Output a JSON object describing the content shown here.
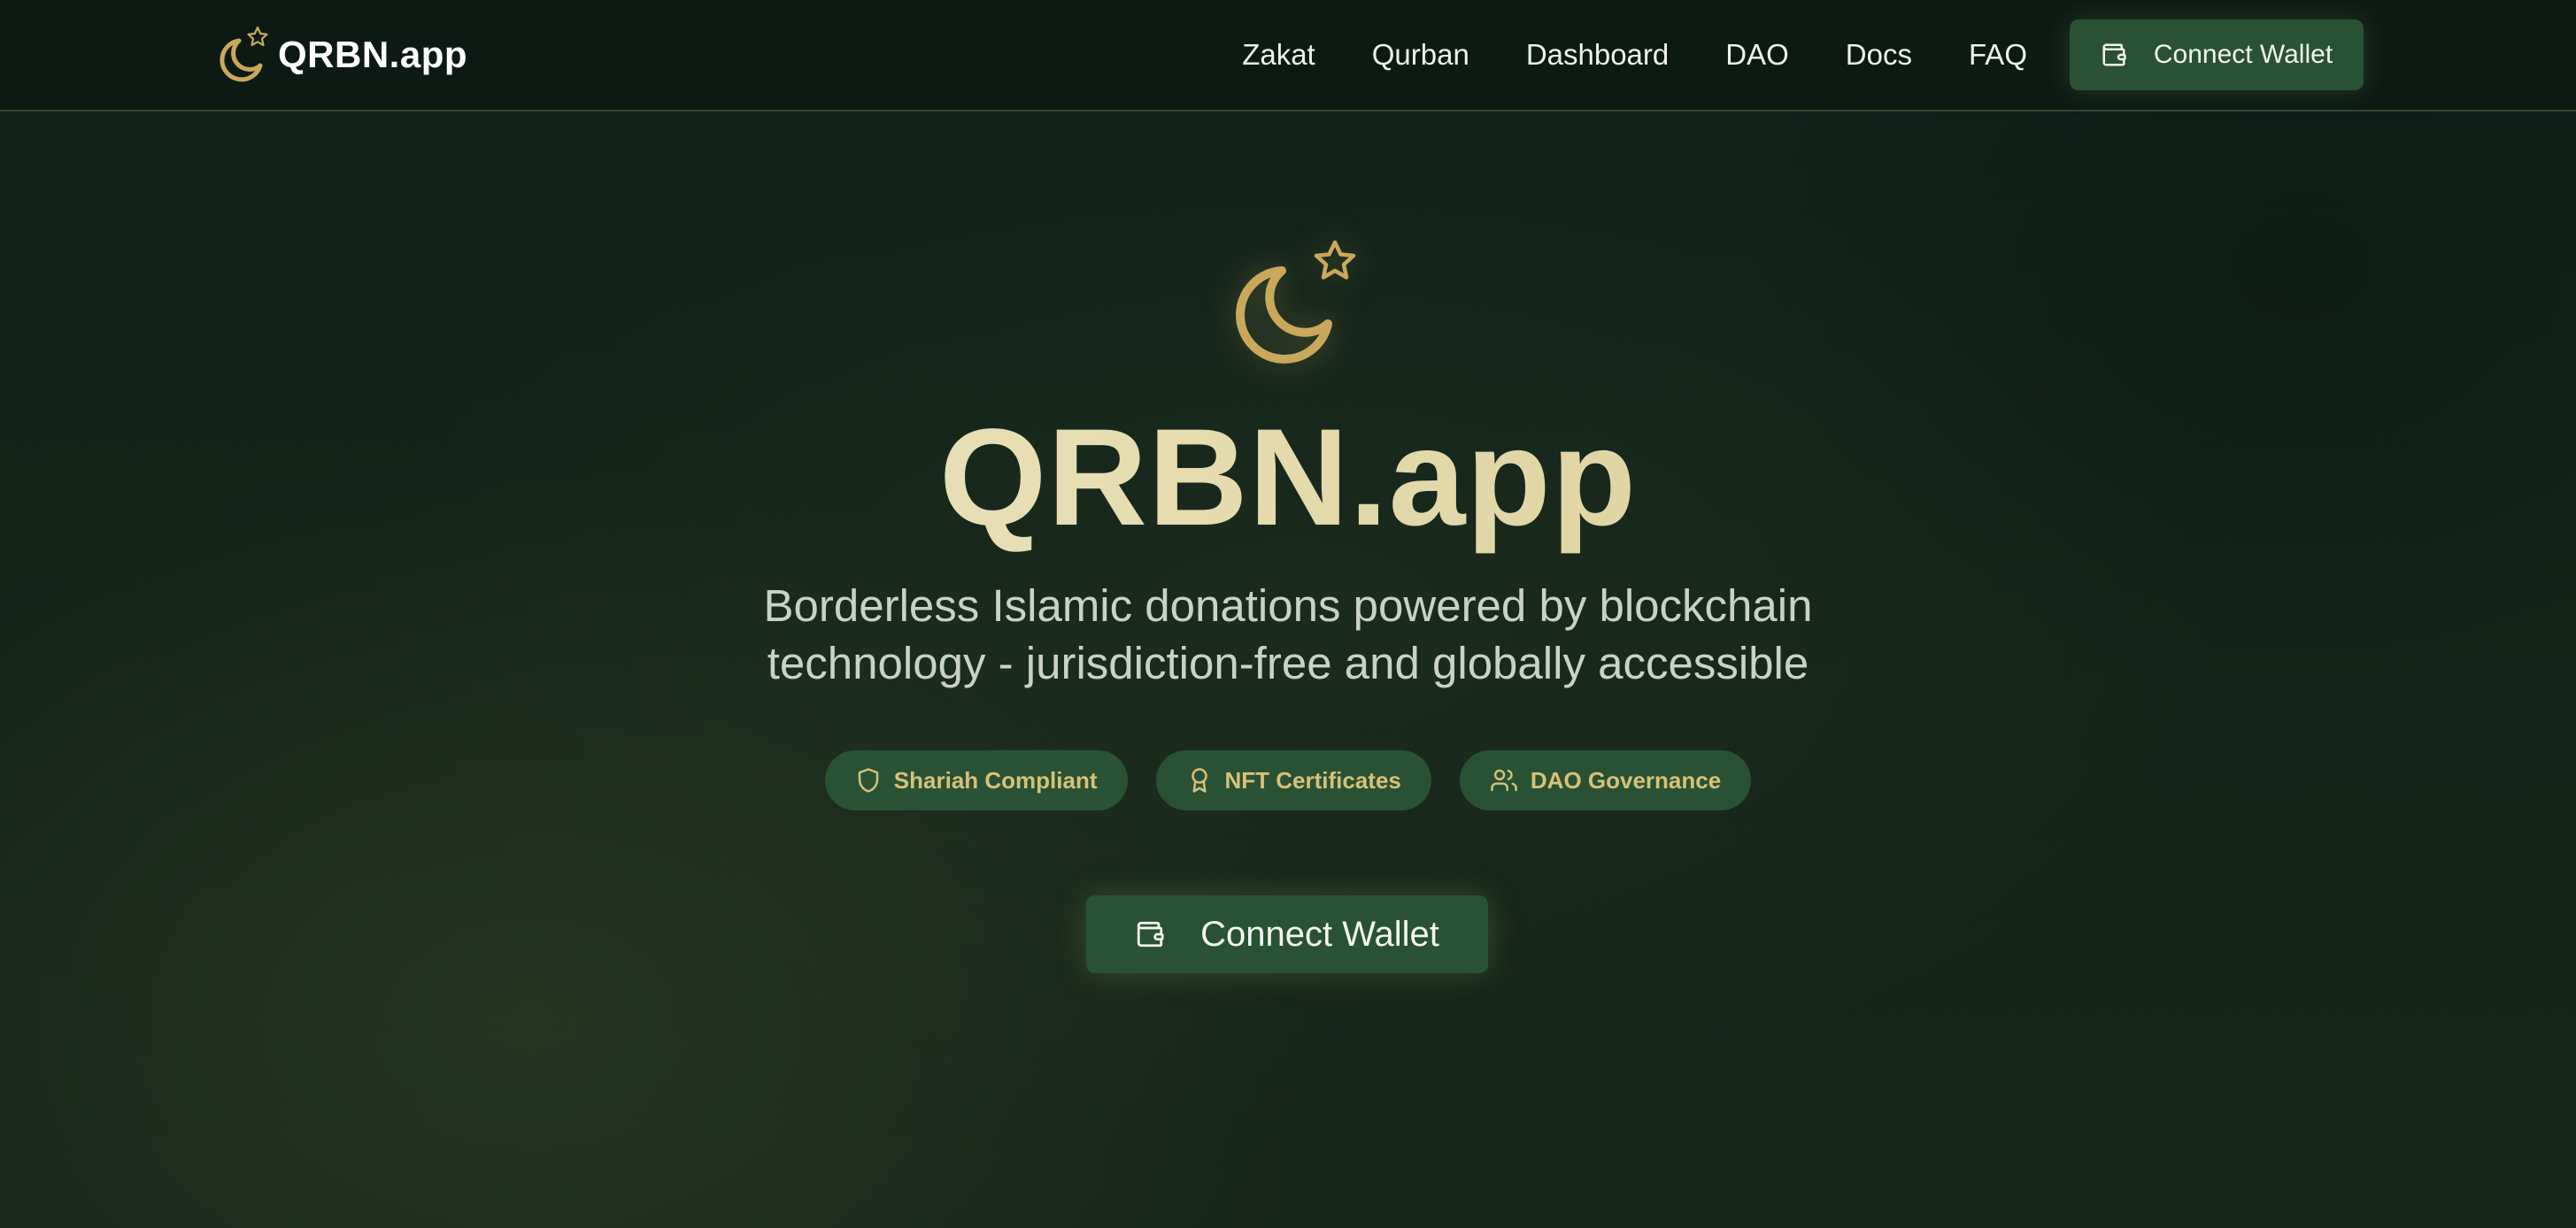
{
  "brand": {
    "name": "QRBN.app",
    "icon": "crescent-star-icon",
    "accent_color": "#c9a85c"
  },
  "nav": {
    "links": [
      "Zakat",
      "Qurban",
      "Dashboard",
      "DAO",
      "Docs",
      "FAQ"
    ],
    "connect_label": "Connect Wallet",
    "connect_icon": "wallet-icon"
  },
  "hero": {
    "icon": "crescent-star-icon",
    "title": "QRBN.app",
    "subtitle": "Borderless Islamic donations powered by blockchain technology - jurisdiction-free and globally accessible",
    "badges": [
      {
        "label": "Shariah Compliant",
        "icon": "shield-icon"
      },
      {
        "label": "NFT Certificates",
        "icon": "award-icon"
      },
      {
        "label": "DAO Governance",
        "icon": "users-icon"
      }
    ],
    "cta_label": "Connect Wallet",
    "cta_icon": "wallet-icon"
  },
  "colors": {
    "background": "#0f1c15",
    "button": "#285233",
    "gold": "#c9a85c",
    "badge_text": "#d7c178",
    "title_gradient": [
      "#f1ead0",
      "#d6c68e"
    ]
  }
}
